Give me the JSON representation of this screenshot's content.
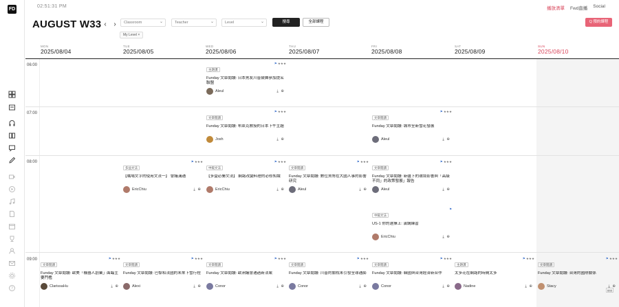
{
  "clock": "02:51:31 PM",
  "top_links": [
    "播放清單",
    "Fwd直播",
    "Social"
  ],
  "header": {
    "title": "AUGUST W33",
    "prev_icon": "chevron-left-icon",
    "next_icon": "chevron-right-icon",
    "filters": [
      {
        "placeholder": "Classroom"
      },
      {
        "placeholder": "Teacher"
      },
      {
        "placeholder": "Level"
      }
    ],
    "search_label": "搜尋",
    "all_courses_label": "全部課程",
    "booking_label": "Q 預約課程",
    "chip_label": "My Level",
    "chip_close": "×"
  },
  "days": [
    {
      "name": "MON",
      "date": "2025/08/04"
    },
    {
      "name": "TUE",
      "date": "2025/08/05"
    },
    {
      "name": "WED",
      "date": "2025/08/06"
    },
    {
      "name": "THU",
      "date": "2025/08/07"
    },
    {
      "name": "FRI",
      "date": "2025/08/08"
    },
    {
      "name": "SAT",
      "date": "2025/08/09"
    },
    {
      "name": "SUN",
      "date": "2025/08/10"
    }
  ],
  "time_slots": [
    "06:00",
    "07:00",
    "08:00",
    "09:00"
  ],
  "cards": [
    {
      "tag": "主題課",
      "stars": "★★★",
      "title": "Funday 文章閱讀: 日本男友川普鼓舞參加提名聯盟",
      "teacher": "Aleul",
      "avatar_color": "#7a6a5a"
    },
    {
      "tag": "文章閱讀",
      "stars": "★★★",
      "title": "Funday 文章閱讀: 布萊克教授的日本下午主題",
      "teacher": "Josh",
      "avatar_color": "#c08a3a"
    },
    {
      "tag": "文章閱讀",
      "stars": "★★★",
      "title": "Funday 文章閱讀: 城市全新雪花發展",
      "teacher": "Aleul",
      "avatar_color": "#6d6d7a"
    },
    {
      "tag": "多益文法",
      "stars": "★★★",
      "title": "【職場文字的使用文法一】 會議溝通",
      "teacher": "EricChiu",
      "avatar_color": "#b07a6a"
    },
    {
      "tag": "中級文法",
      "stars": "★★★",
      "title": "【多益必勝文法】 網路改變料理的必修知識",
      "teacher": "EricChiu",
      "avatar_color": "#b07a6a"
    },
    {
      "tag": "文章閱讀",
      "stars": "★★★",
      "title": "Funday 文章閱讀: 數位貨幣在大國人事的影響研究",
      "teacher": "Aleul",
      "avatar_color": "#6d6d7a"
    },
    {
      "tag": "文章閱讀",
      "stars": "★★★",
      "title": "Funday 文章閱讀: 新疆下的環境影響與「高級不同」的政策發展」報告",
      "teacher": "Aleul",
      "avatar_color": "#6d6d7a"
    },
    {
      "tag": "中級文法",
      "stars": "",
      "title": "US-1 你的選擇上: 演講練習",
      "teacher": "EricChiu",
      "avatar_color": "#b07a6a"
    },
    {
      "tag": "文章閱讀",
      "stars": "★★★",
      "title": "Funday 文章閱讀: 歐美「機器人創業」面臨主要門檻",
      "teacher": "ClarissaHu",
      "avatar_color": "#5a4a3a"
    },
    {
      "tag": "文章閱讀",
      "stars": "★★★",
      "title": "Funday 文章閱讀: 巴黎和法國的未來下雪行程",
      "teacher": "Alexi",
      "avatar_color": "#8a6a6a"
    },
    {
      "tag": "文章閱讀",
      "stars": "★★★",
      "title": "Funday 文章閱讀: 歐洲議會通過新法案",
      "teacher": "Conor",
      "avatar_color": "#7a7aa0"
    },
    {
      "tag": "文章閱讀",
      "stars": "★★★",
      "title": "Funday 文章閱讀: 川普的關稅未引發全球通膨",
      "teacher": "Conor",
      "avatar_color": "#7a7aa0"
    },
    {
      "tag": "文章閱讀",
      "stars": "★★★",
      "title": "Funday 文章閱讀: 韓國與台灣經濟新合作",
      "teacher": "Conor",
      "avatar_color": "#7a7aa0"
    },
    {
      "tag": "主題課",
      "stars": "★★★",
      "title": "太多花在網路的時間太多",
      "teacher": "Nadine",
      "avatar_color": "#8a6a8a"
    },
    {
      "tag": "文章閱讀",
      "stars": "★★★",
      "title": "Funday 文章閱讀: 台灣的國際關係",
      "teacher": "Stacy",
      "avatar_color": "#c09070"
    }
  ],
  "corner_label": "▤▤"
}
